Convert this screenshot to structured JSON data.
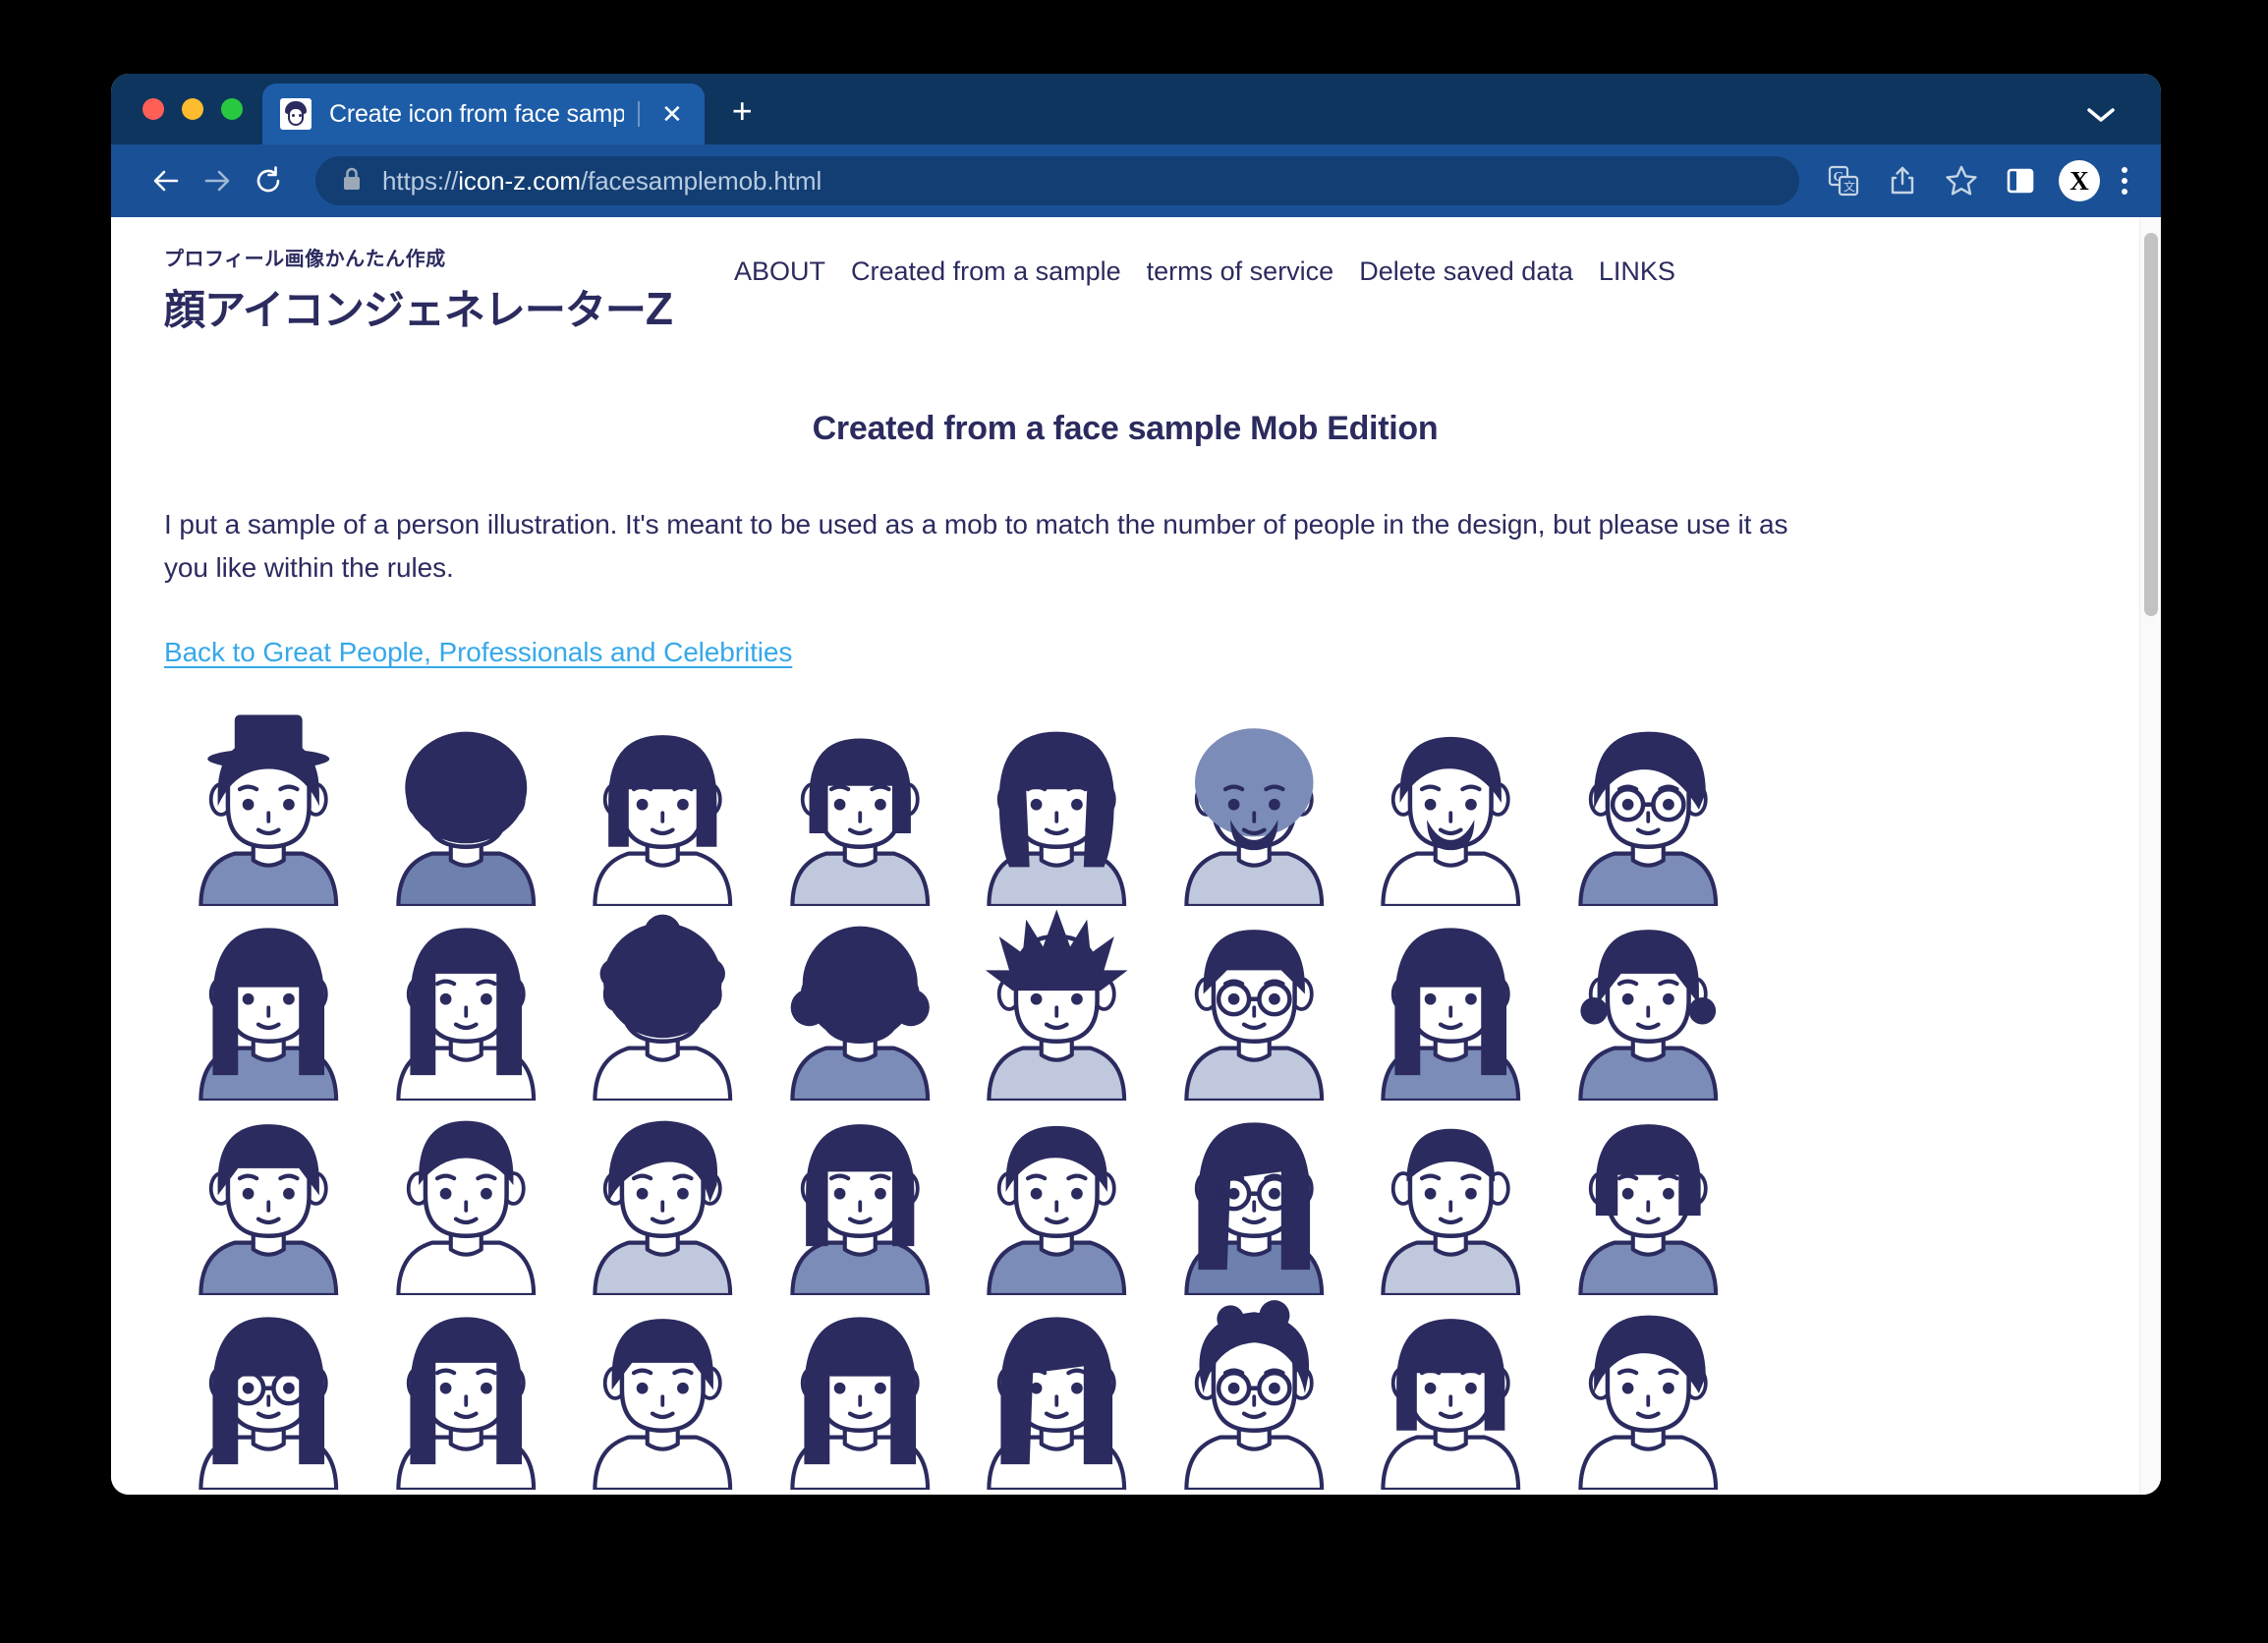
{
  "browser": {
    "tab": {
      "title": "Create icon from face sample |",
      "favicon_name": "face-icon-favicon",
      "close_label": "✕"
    },
    "new_tab_label": "+",
    "tab_list_chevron": "chevron-down-icon",
    "toolbar": {
      "back_icon": "back-arrow-icon",
      "forward_icon": "forward-arrow-icon",
      "reload_icon": "reload-icon",
      "lock_icon": "lock-icon",
      "url_scheme": "https://",
      "url_host": "icon-z.com",
      "url_path": "/facesamplemob.html",
      "translate_icon": "google-translate-icon",
      "share_icon": "share-icon",
      "bookmark_icon": "bookmark-star-icon",
      "side_panel_icon": "side-panel-icon",
      "profile_label": "X",
      "menu_icon": "three-dot-menu-icon"
    },
    "traffic_lights": {
      "close": "#FF5F57",
      "minimize": "#FEBC2E",
      "maximize": "#28C840"
    }
  },
  "site": {
    "brand": {
      "subtitle": "プロフィール画像かんたん作成",
      "title": "顔アイコンジェネレーター",
      "title_mark": "Z"
    },
    "nav": [
      {
        "label": "ABOUT"
      },
      {
        "label": "Created from a sample"
      },
      {
        "label": "terms of service"
      },
      {
        "label": "Delete saved data"
      },
      {
        "label": "LINKS"
      }
    ],
    "heading": "Created from a face sample Mob Edition",
    "paragraph": "I put a sample of a person illustration. It's meant to be used as a mob to match the number of people in the design, but please use it as you like within the rules.",
    "back_link": "Back to Great People, Professionals and Celebrities"
  },
  "colors": {
    "ink": "#2B2B5F",
    "link": "#37A8E8",
    "clothing_mid": "#7B8CB8",
    "clothing_light": "#BFC8DC",
    "tab_strip": "#0E355E",
    "toolbar": "#1A5096",
    "active_tab": "#1D5DA8",
    "omnibox": "#123E73",
    "scrollbar_thumb": "#C2C2C2"
  },
  "avatar_grid": {
    "columns": 8,
    "rows": [
      [
        {
          "name": "man-with-hat-grin",
          "hair": "short-messy",
          "hat": true,
          "glasses": false,
          "clothing": "#7B8CB8"
        },
        {
          "name": "person-afro-tongue-out",
          "hair": "afro-round",
          "hat": false,
          "glasses": false,
          "clothing": "#6E80AD"
        },
        {
          "name": "person-bob-neutral",
          "hair": "bob-straight",
          "hat": false,
          "glasses": false,
          "clothing": "#FFFFFF"
        },
        {
          "name": "person-bob-smiling",
          "hair": "bob-short",
          "hat": false,
          "glasses": false,
          "clothing": "#BFC8DC"
        },
        {
          "name": "person-wavy-shocked",
          "hair": "wavy-long",
          "hat": false,
          "glasses": false,
          "clothing": "#BFC8DC"
        },
        {
          "name": "bearded-man-angry",
          "hair": "wavy-volume",
          "hat": false,
          "glasses": false,
          "beard": true,
          "clothing": "#BFC8DC"
        },
        {
          "name": "goatee-man-serious",
          "hair": "short-parted",
          "hat": false,
          "glasses": false,
          "beard": true,
          "clothing": "#FFFFFF"
        },
        {
          "name": "man-glasses-surprised",
          "hair": "short-swept",
          "hat": false,
          "glasses": true,
          "clothing": "#7B8CB8"
        }
      ],
      [
        {
          "name": "woman-long-hair-upset",
          "hair": "long-straight",
          "hat": false,
          "glasses": false,
          "clothing": "#7B8CB8"
        },
        {
          "name": "girl-long-hair-sad",
          "hair": "long-bangs",
          "hat": false,
          "glasses": false,
          "clothing": "#FFFFFF"
        },
        {
          "name": "person-curly-afro-shocked",
          "hair": "afro-curly",
          "hat": false,
          "glasses": false,
          "clothing": "#FFFFFF"
        },
        {
          "name": "person-curly-surprised",
          "hair": "curly-medium",
          "hat": false,
          "glasses": false,
          "clothing": "#7B8CB8"
        },
        {
          "name": "spiky-hair-man-angry",
          "hair": "spiky",
          "hat": false,
          "glasses": false,
          "clothing": "#BFC8DC"
        },
        {
          "name": "man-round-glasses-smile",
          "hair": "short-fringe",
          "hat": false,
          "glasses": true,
          "clothing": "#BFC8DC"
        },
        {
          "name": "woman-long-hair-laughing",
          "hair": "long-straight",
          "hat": false,
          "glasses": false,
          "clothing": "#7B8CB8"
        },
        {
          "name": "elderly-person-frowning",
          "hair": "short-curled",
          "hat": false,
          "glasses": false,
          "clothing": "#7B8CB8"
        }
      ],
      [
        {
          "name": "child-short-hair-pout",
          "hair": "short-bowl",
          "hat": false,
          "glasses": false,
          "clothing": "#7B8CB8"
        },
        {
          "name": "man-open-mouth-worried",
          "hair": "short-up",
          "hat": false,
          "glasses": false,
          "clothing": "#FFFFFF"
        },
        {
          "name": "young-man-scarf",
          "hair": "swept-side",
          "hat": false,
          "glasses": false,
          "clothing": "#BFC8DC"
        },
        {
          "name": "woman-bob-determined",
          "hair": "bob-bangs",
          "hat": false,
          "glasses": false,
          "clothing": "#7B8CB8"
        },
        {
          "name": "businessman-suit-tie",
          "hair": "short-parted",
          "hat": false,
          "glasses": false,
          "clothing": "#7B8CB8"
        },
        {
          "name": "woman-round-glasses",
          "hair": "long-side",
          "hat": false,
          "glasses": true,
          "clothing": "#6E80AD"
        },
        {
          "name": "elderly-man-squinting",
          "hair": "short-thin",
          "hat": false,
          "glasses": false,
          "clothing": "#BFC8DC"
        },
        {
          "name": "woman-wavy-smiling-collar",
          "hair": "wavy-short",
          "hat": false,
          "glasses": false,
          "clothing": "#7B8CB8"
        }
      ],
      [
        {
          "name": "woman-glasses-partial",
          "hair": "long-straight",
          "hat": false,
          "glasses": true,
          "clothing": "#FFFFFF"
        },
        {
          "name": "person-bangs-partial",
          "hair": "long-bangs",
          "hat": false,
          "glasses": false,
          "clothing": "#FFFFFF"
        },
        {
          "name": "boy-short-hair-partial",
          "hair": "short-bowl",
          "hat": false,
          "glasses": false,
          "clothing": "#FFFFFF"
        },
        {
          "name": "girl-long-hair-partial",
          "hair": "long-straight",
          "hat": false,
          "glasses": false,
          "clothing": "#FFFFFF"
        },
        {
          "name": "woman-side-part-partial",
          "hair": "long-side",
          "hat": false,
          "glasses": false,
          "clothing": "#FFFFFF"
        },
        {
          "name": "person-messy-glasses-partial",
          "hair": "messy-volume",
          "hat": false,
          "glasses": true,
          "clothing": "#FFFFFF"
        },
        {
          "name": "person-bob-square-partial",
          "hair": "bob-straight",
          "hat": false,
          "glasses": false,
          "clothing": "#FFFFFF"
        },
        {
          "name": "person-short-hair-partial",
          "hair": "short-swept",
          "hat": false,
          "glasses": false,
          "clothing": "#FFFFFF"
        }
      ]
    ]
  }
}
